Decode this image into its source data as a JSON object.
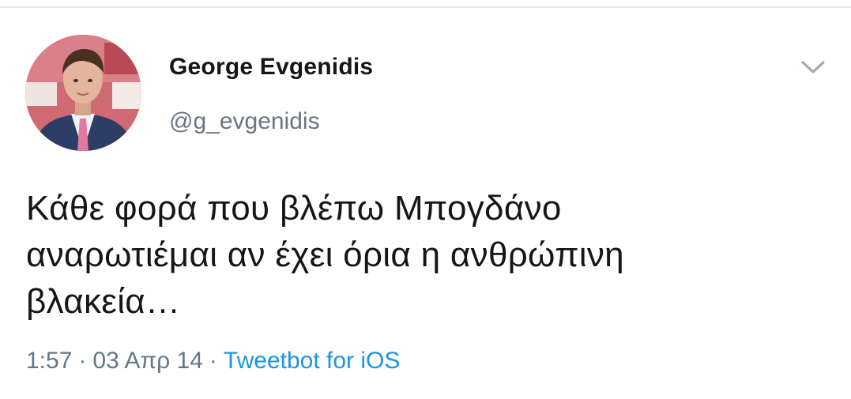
{
  "tweet": {
    "author": {
      "display_name": "George Evgenidis",
      "handle": "@g_evgenidis"
    },
    "text": "Κάθε φορά που βλέπω Μπογδάνο\nαναρωτιέμαι αν έχει όρια η ανθρώπινη\nβλακεία…",
    "time": "1:57",
    "date": "03 Απρ 14",
    "separator": "·",
    "source": "Tweetbot for iOS",
    "icons": {
      "menu": "chevron-down-icon",
      "avatar": "profile-photo"
    },
    "colors": {
      "text": "#14171a",
      "secondary": "#657786",
      "link": "#1b95e0"
    }
  }
}
